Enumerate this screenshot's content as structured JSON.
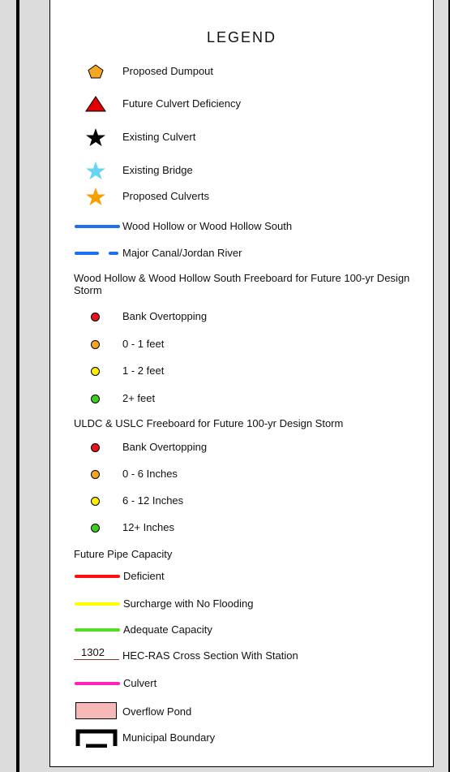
{
  "legend": {
    "title": "LEGEND",
    "items": [
      {
        "label": "Proposed Dumpout"
      },
      {
        "label": "Future Culvert Deficiency"
      },
      {
        "label": "Existing Culvert"
      },
      {
        "label": "Existing Bridge"
      },
      {
        "label": "Proposed Culverts"
      },
      {
        "label": "Wood Hollow or Wood Hollow South"
      },
      {
        "label": "Major Canal/Jordan River"
      }
    ],
    "section_wood_hollow": {
      "heading": "Wood Hollow & Wood Hollow South Freeboard for Future 100-yr Design Storm",
      "items": [
        {
          "label": "Bank Overtopping",
          "color": "#e8141c"
        },
        {
          "label": "0 - 1 feet",
          "color": "#f5a623"
        },
        {
          "label": "1 - 2 feet",
          "color": "#ffee00"
        },
        {
          "label": "2+ feet",
          "color": "#3ccf1e"
        }
      ]
    },
    "section_uldc": {
      "heading": "ULDC & USLC Freeboard for Future 100-yr Design Storm",
      "items": [
        {
          "label": "Bank Overtopping",
          "color": "#e8141c"
        },
        {
          "label": "0 - 6 Inches",
          "color": "#f5a623"
        },
        {
          "label": "6 - 12 Inches",
          "color": "#ffee00"
        },
        {
          "label": "12+ Inches",
          "color": "#3ccf1e"
        }
      ]
    },
    "section_pipe": {
      "heading": "Future Pipe Capacity",
      "items": [
        {
          "label": "Deficient",
          "color": "#ff1010"
        },
        {
          "label": "Surcharge with No Flooding",
          "color": "#ffff00"
        },
        {
          "label": "Adequate Capacity",
          "color": "#55dd22"
        }
      ]
    },
    "cross_section": {
      "station": "1302",
      "label": "HEC-RAS Cross Section With Station"
    },
    "culvert": {
      "label": "Culvert",
      "color": "#ff22bb"
    },
    "overflow_pond": {
      "label": "Overflow Pond",
      "color": "#f7b8b8"
    },
    "municipal_boundary": {
      "label": "Municipal Boundary"
    }
  },
  "colors": {
    "dumpout": "#f5a623",
    "culvert_deficiency": "#e00000",
    "existing_culvert": "#000000",
    "existing_bridge": "#66d4f2",
    "proposed_culverts": "#f5a000",
    "wood_hollow_line": "#1f6ff2",
    "canal_line": "#1f6ff2",
    "cross_section_line": "#8b3a2a"
  }
}
